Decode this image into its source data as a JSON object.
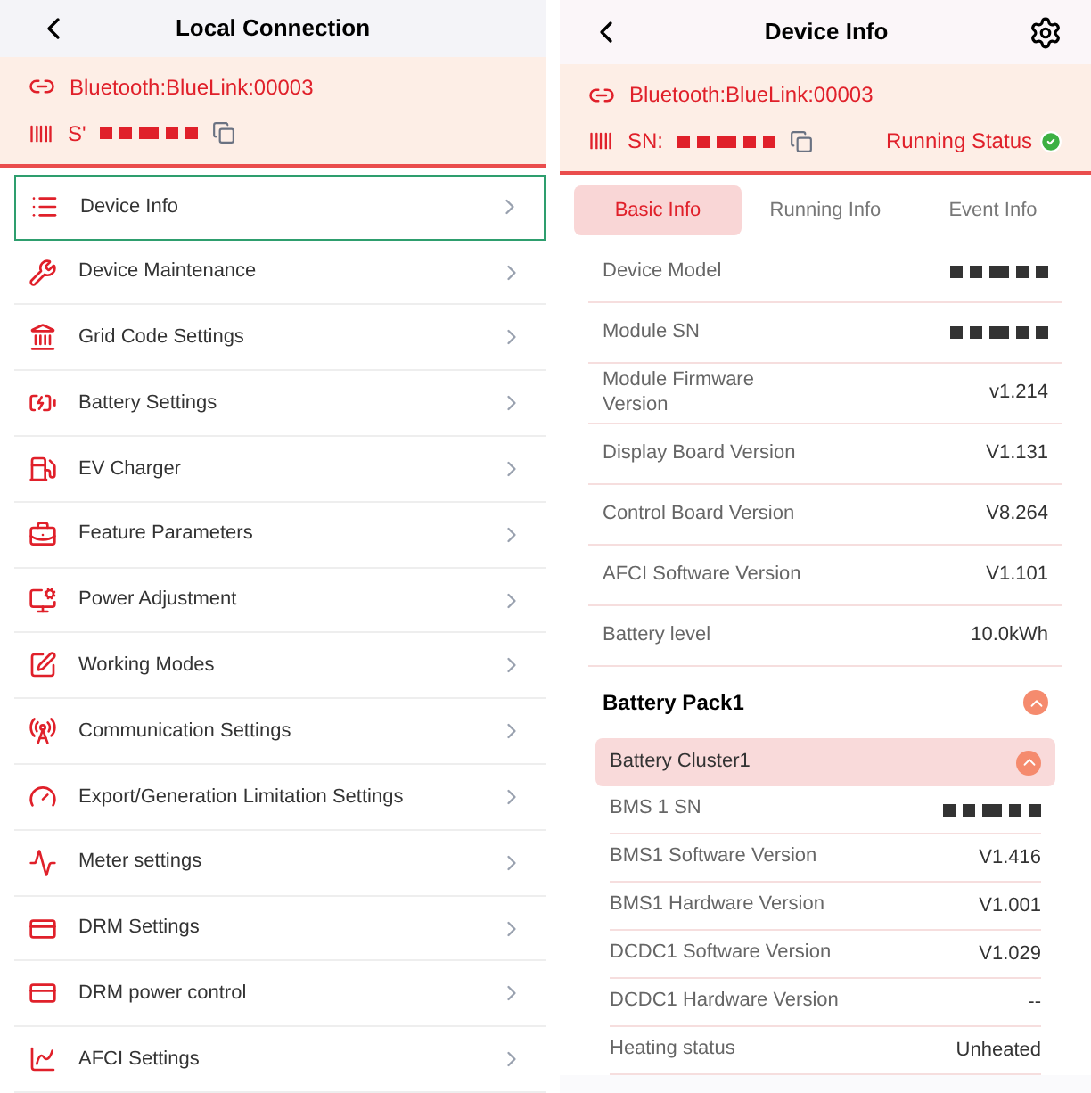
{
  "left": {
    "title": "Local Connection",
    "connection": {
      "bluetooth": "Bluetooth:BlueLink:00003",
      "sn_prefix": "S'"
    },
    "menu": [
      {
        "label": "Device Info",
        "selected": true
      },
      {
        "label": "Device Maintenance",
        "selected": false
      },
      {
        "label": "Grid Code Settings",
        "selected": false
      },
      {
        "label": "Battery Settings",
        "selected": false
      },
      {
        "label": "EV Charger",
        "selected": false
      },
      {
        "label": "Feature Parameters",
        "selected": false
      },
      {
        "label": "Power Adjustment",
        "selected": false
      },
      {
        "label": "Working Modes",
        "selected": false
      },
      {
        "label": "Communication Settings",
        "selected": false
      },
      {
        "label": "Export/Generation Limitation Settings",
        "selected": false
      },
      {
        "label": "Meter settings",
        "selected": false
      },
      {
        "label": "DRM Settings",
        "selected": false
      },
      {
        "label": "DRM power control",
        "selected": false
      },
      {
        "label": "AFCI Settings",
        "selected": false
      }
    ]
  },
  "right": {
    "title": "Device Info",
    "connection": {
      "bluetooth": "Bluetooth:BlueLink:00003",
      "sn_prefix": "SN:",
      "status": "Running Status",
      "status_ok": true
    },
    "tabs": [
      {
        "label": "Basic Info",
        "selected": true
      },
      {
        "label": "Running Info",
        "selected": false
      },
      {
        "label": "Event Info",
        "selected": false
      }
    ],
    "basic": [
      {
        "label": "Device Model",
        "kind": "redacted"
      },
      {
        "label": "Module SN",
        "kind": "redacted"
      },
      {
        "label": "Module Firmware Version",
        "value": "v1.214",
        "kind": "text"
      },
      {
        "label": "Display Board Version",
        "value": "V1.131",
        "kind": "text"
      },
      {
        "label": "Control Board Version",
        "value": "V8.264",
        "kind": "text"
      },
      {
        "label": "AFCI Software Version",
        "value": "V1.101",
        "kind": "text"
      },
      {
        "label": "Battery level",
        "value": "10.0kWh",
        "kind": "text"
      }
    ],
    "pack": {
      "title": "Battery Pack1",
      "expanded": true,
      "cluster": {
        "title": "Battery Cluster1",
        "expanded": true,
        "rows": [
          {
            "label": "BMS 1 SN",
            "kind": "redacted"
          },
          {
            "label": "BMS1 Software Version",
            "value": "V1.416",
            "kind": "text"
          },
          {
            "label": "BMS1 Hardware Version",
            "value": "V1.001",
            "kind": "text"
          },
          {
            "label": "DCDC1 Software Version",
            "value": "V1.029",
            "kind": "text"
          },
          {
            "label": "DCDC1 Hardware Version",
            "value": "--",
            "kind": "text"
          },
          {
            "label": "Heating status",
            "value": "Unheated",
            "kind": "text"
          }
        ]
      }
    }
  }
}
